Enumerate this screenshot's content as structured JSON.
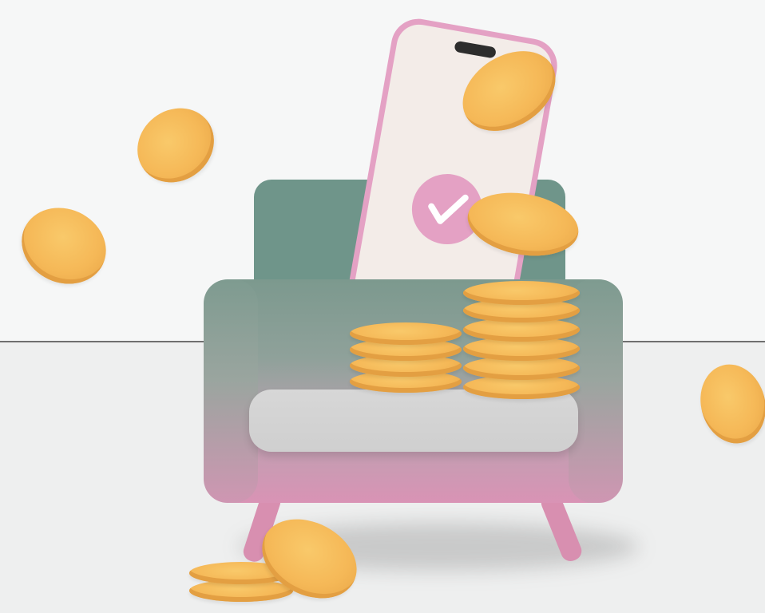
{
  "scene": {
    "subject": "armchair-phone-coins",
    "colors": {
      "wall": "#f6f7f7",
      "floor": "#eeefef",
      "armchair_top": "#6f958a",
      "armchair_bottom": "#d993b5",
      "cushion": "#d3d3d3",
      "phone_frame": "#e4a1c4",
      "phone_screen": "#f3ece8",
      "coin": "#f5b857",
      "check_mark": "#ffffff"
    },
    "icons": [
      "check-mark-icon"
    ],
    "stacks": {
      "left_stack_coins": 4,
      "right_stack_coins": 6,
      "floor_stack_coins": 2
    },
    "falling_coins": 6
  }
}
